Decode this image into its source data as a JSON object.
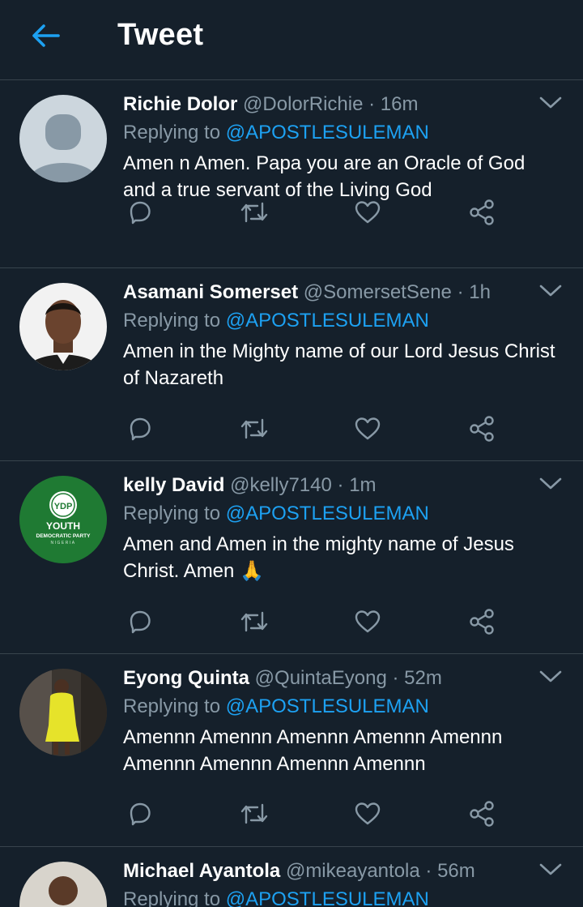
{
  "header": {
    "title": "Tweet",
    "back_icon": "arrow-left-icon"
  },
  "colors": {
    "background": "#15202b",
    "accent": "#1da1f2",
    "muted": "#8899a6",
    "divider": "#38444d"
  },
  "tweets": [
    {
      "name": "Richie Dolor",
      "handle": "@DolorRichie",
      "dot": "·",
      "time": "16m",
      "replying_prefix": "Replying to",
      "replying_to": "@APOSTLESULEMAN",
      "text": "Amen n Amen. Papa you are an Oracle of God and a true servant of the Living God"
    },
    {
      "name": "Asamani Somerset",
      "handle": "@SomersetSene",
      "dot": "·",
      "time": "1h",
      "replying_prefix": "Replying to",
      "replying_to": "@APOSTLESULEMAN",
      "text": "Amen in the Mighty name of our Lord Jesus Christ of Nazareth"
    },
    {
      "name": "kelly David",
      "handle": "@kelly7140",
      "dot": "·",
      "time": "1m",
      "replying_prefix": "Replying to",
      "replying_to": "@APOSTLESULEMAN",
      "text": "Amen and Amen in the mighty name of Jesus Christ. Amen 🙏",
      "avatar_logo": {
        "letters": "YDP",
        "line1": "YOUTH",
        "line2": "DEMOCRATIC PARTY",
        "line3": "NIGERIA"
      }
    },
    {
      "name": "Eyong Quinta",
      "handle": "@QuintaEyong",
      "dot": "·",
      "time": "52m",
      "replying_prefix": "Replying to",
      "replying_to": "@APOSTLESULEMAN",
      "text": "Amennn Amennn Amennn Amennn Amennn Amennn Amennn Amennn Amennn"
    },
    {
      "name": "Michael Ayantola",
      "handle": "@mikeayantola",
      "dot": "·",
      "time": "56m",
      "replying_prefix": "Replying to",
      "replying_to": "@APOSTLESULEMAN",
      "text": ""
    }
  ]
}
